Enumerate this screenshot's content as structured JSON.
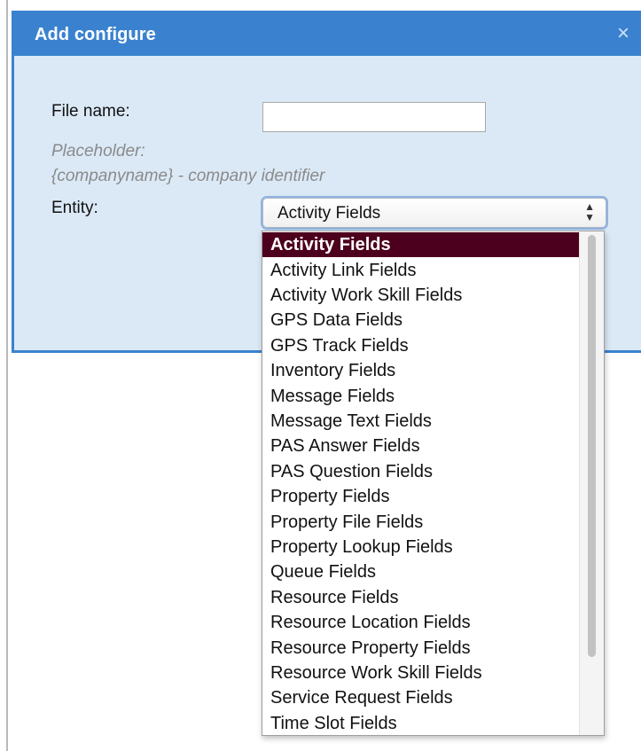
{
  "dialog": {
    "title": "Add configure",
    "close_symbol": "×"
  },
  "form": {
    "file_name_label": "File name:",
    "file_name_value": "",
    "placeholder_title": "Placeholder:",
    "placeholder_desc": "{companyname} - company identifier",
    "entity_label": "Entity:",
    "entity_selected": "Activity Fields",
    "entity_options": [
      "Activity Fields",
      "Activity Link Fields",
      "Activity Work Skill Fields",
      "GPS Data Fields",
      "GPS Track Fields",
      "Inventory Fields",
      "Message Fields",
      "Message Text Fields",
      "PAS Answer Fields",
      "PAS Question Fields",
      "Property Fields",
      "Property File Fields",
      "Property Lookup Fields",
      "Queue Fields",
      "Resource Fields",
      "Resource Location Fields",
      "Resource Property Fields",
      "Resource Work Skill Fields",
      "Service Request Fields",
      "Time Slot Fields"
    ]
  },
  "colors": {
    "titlebar": "#3a82cf",
    "dialog_body": "#dbe9f7",
    "selected_option": "#4d001d"
  },
  "icons": {
    "close": "close-icon",
    "select_arrows": "chevron-up-down-icon"
  }
}
